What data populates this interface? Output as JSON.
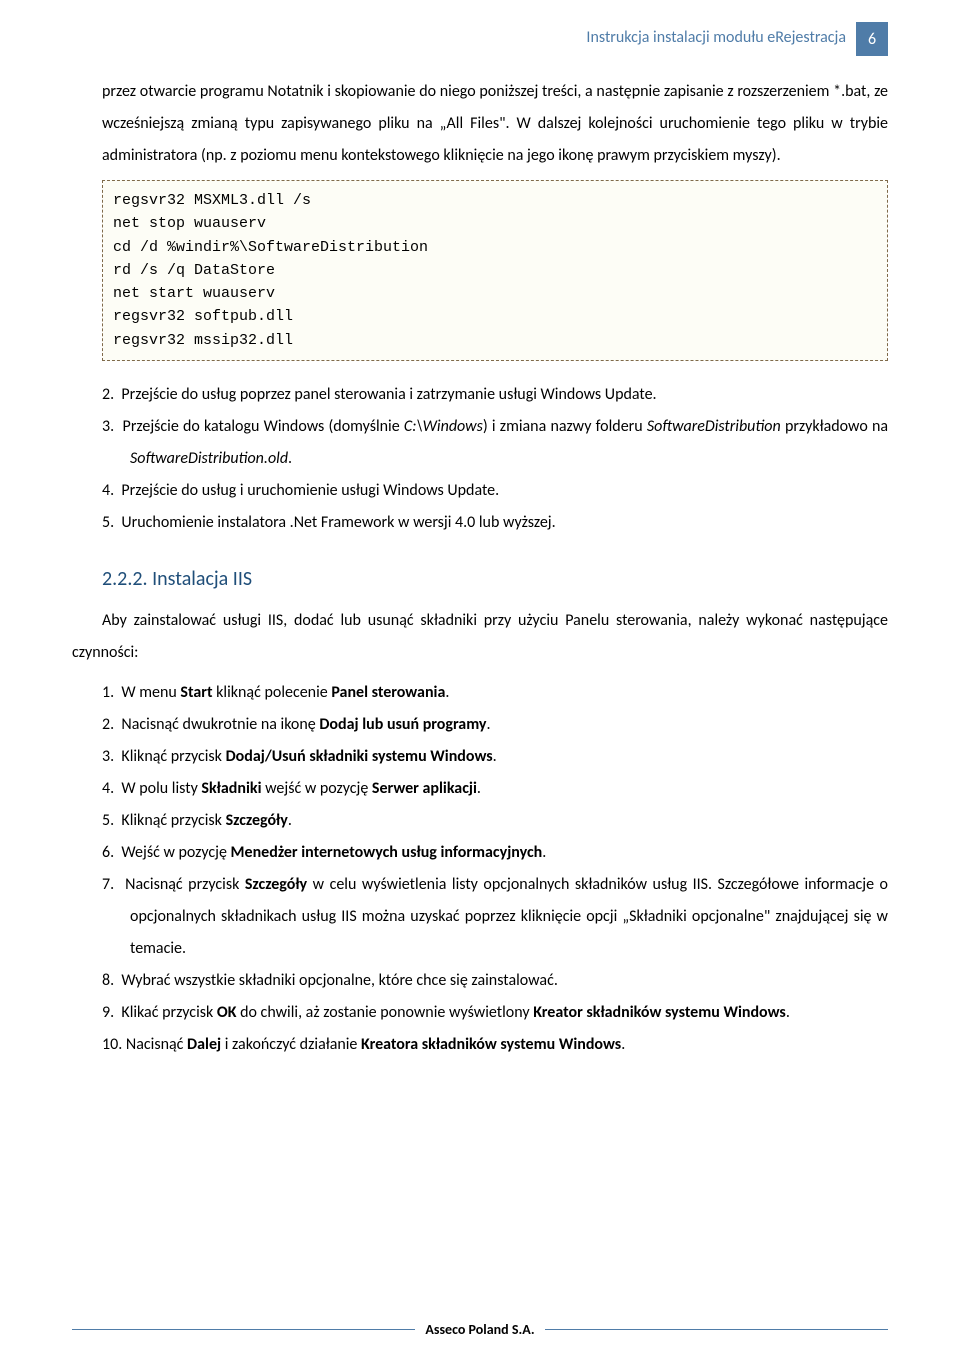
{
  "header": {
    "title": "Instrukcja instalacji modułu eRejestracja",
    "page_number": "6"
  },
  "intro_paragraph": "przez otwarcie programu Notatnik i skopiowanie do niego poniższej treści,  a następnie zapisanie z rozszerzeniem *.bat, ze wcześniejszą zmianą typu zapisywanego pliku na „All Files\". W dalszej kolejności uruchomienie tego pliku w trybie administratora (np. z poziomu menu kontekstowego kliknięcie na jego ikonę prawym przyciskiem myszy).",
  "code": {
    "l1": "regsvr32 MSXML3.dll /s",
    "l2": "net stop wuauserv",
    "l3": "cd /d %windir%\\SoftwareDistribution",
    "l4": "rd /s /q DataStore",
    "l5": "net start wuauserv",
    "l6": "regsvr32 softpub.dll",
    "l7": "regsvr32 mssip32.dll"
  },
  "list_a": {
    "i2": {
      "n": "2.",
      "t": "Przejście do usług poprzez panel sterowania i zatrzymanie usługi Windows Update."
    },
    "i3": {
      "n": "3.",
      "pre": "Przejście do katalogu Windows (domyślnie ",
      "it1": "C:\\Windows",
      "mid1": ") i zmiana nazwy folderu ",
      "it2": "SoftwareDistribution",
      "mid2": " przykładowo na ",
      "it3": "SoftwareDistribution.old",
      "post": "."
    },
    "i4": {
      "n": "4.",
      "t": "Przejście do usług i uruchomienie usługi Windows Update."
    },
    "i5": {
      "n": "5.",
      "t": "Uruchomienie instalatora .Net Framework w wersji 4.0 lub wyższej."
    }
  },
  "section": {
    "num": "2.2.2.",
    "title": "Instalacja IIS",
    "intro": "Aby zainstalować usługi IIS, dodać lub usunąć składniki przy użyciu Panelu sterowania, należy wykonać następujące czynności:"
  },
  "list_b": {
    "i1": {
      "n": "1.",
      "a": "W menu ",
      "b": "Start",
      "c": " kliknąć polecenie ",
      "d": "Panel sterowania",
      "e": "."
    },
    "i2": {
      "n": "2.",
      "a": "Nacisnąć dwukrotnie na ikonę ",
      "b": "Dodaj lub usuń programy",
      "c": "."
    },
    "i3": {
      "n": "3.",
      "a": "Kliknąć przycisk ",
      "b": "Dodaj/Usuń składniki systemu Windows",
      "c": "."
    },
    "i4": {
      "n": "4.",
      "a": "W polu listy ",
      "b": "Składniki",
      "c": " wejść w pozycję ",
      "d": "Serwer aplikacji",
      "e": "."
    },
    "i5": {
      "n": "5.",
      "a": "Kliknąć przycisk ",
      "b": "Szczegóły",
      "c": "."
    },
    "i6": {
      "n": "6.",
      "a": "Wejść w pozycję ",
      "b": "Menedżer internetowych usług informacyjnych",
      "c": "."
    },
    "i7": {
      "n": "7.",
      "a": "Nacisnąć przycisk ",
      "b": "Szczegóły",
      "c": " w celu wyświetlenia listy opcjonalnych składników usług IIS. Szczegółowe informacje o opcjonalnych składnikach usług IIS można uzyskać poprzez kliknięcie opcji „Składniki opcjonalne\"  znajdującej się w temacie."
    },
    "i8": {
      "n": "8.",
      "a": "Wybrać wszystkie składniki opcjonalne, które chce się zainstalować."
    },
    "i9": {
      "n": "9.",
      "a": "Klikać przycisk ",
      "b": "OK",
      "c": " do chwili, aż zostanie ponownie wyświetlony ",
      "d": "Kreator składników systemu Windows",
      "e": "."
    },
    "i10": {
      "n": "10.",
      "a": "Nacisnąć ",
      "b": "Dalej",
      "c": " i zakończyć działanie ",
      "d": "Kreatora składników systemu Windows",
      "e": "."
    }
  },
  "footer": {
    "text": "Asseco Poland S.A."
  }
}
